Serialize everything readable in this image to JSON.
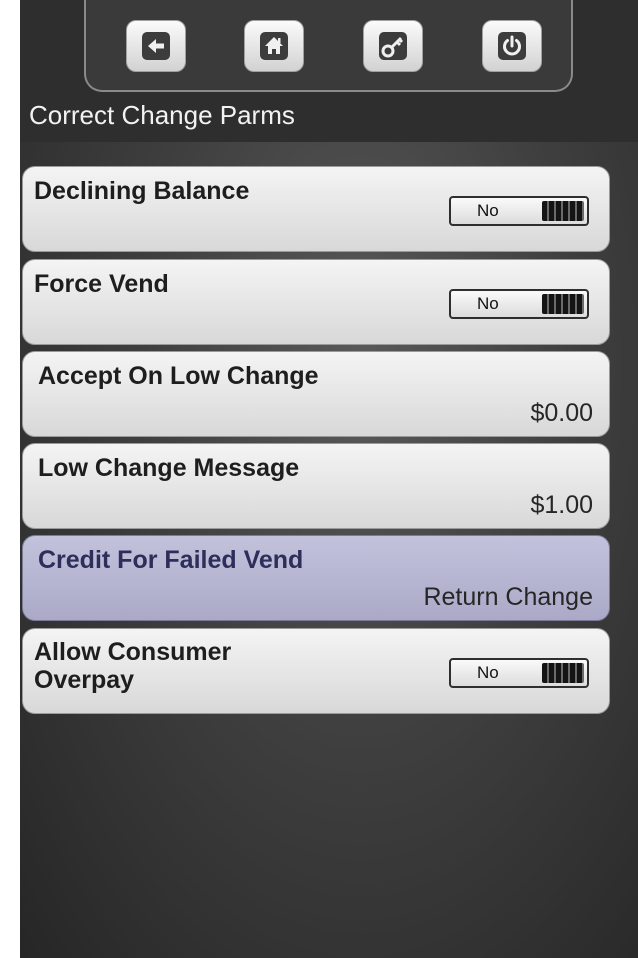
{
  "header": {
    "title": "Correct Change Parms",
    "buttons": [
      {
        "name": "back",
        "icon": "arrow-left-icon"
      },
      {
        "name": "home",
        "icon": "home-icon"
      },
      {
        "name": "key",
        "icon": "key-icon"
      },
      {
        "name": "power",
        "icon": "power-icon"
      }
    ]
  },
  "settings": [
    {
      "label": "Declining Balance",
      "control": "toggle",
      "value": "No"
    },
    {
      "label": "Force Vend",
      "control": "toggle",
      "value": "No"
    },
    {
      "label": "Accept On Low Change",
      "control": "value",
      "value": "$0.00"
    },
    {
      "label": "Low Change Message",
      "control": "value",
      "value": "$1.00"
    },
    {
      "label": "Credit For Failed Vend",
      "control": "value",
      "value": "Return Change",
      "selected": true
    },
    {
      "label": "Allow Consumer Overpay",
      "control": "toggle",
      "value": "No"
    }
  ],
  "colors": {
    "selected_row": "#b4b4d0",
    "row": "#e6e6e6",
    "background": "#3a3a3a"
  }
}
